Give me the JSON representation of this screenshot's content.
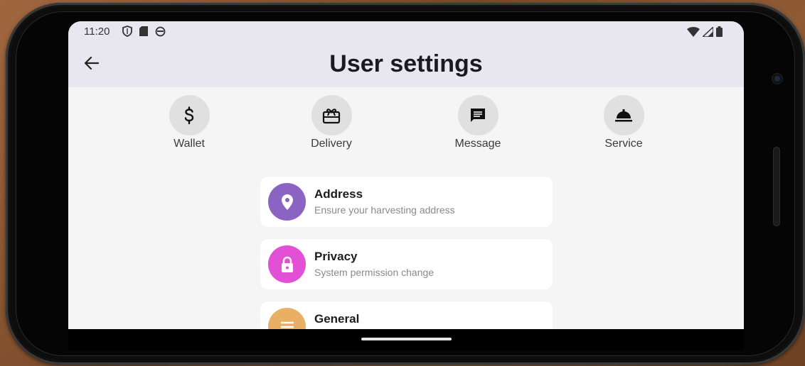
{
  "status_bar": {
    "time": "11:20",
    "left_icons": [
      "shield-icon",
      "sd-card-icon",
      "sync-icon"
    ],
    "right_icons": [
      "wifi-icon",
      "signal-icon",
      "battery-icon"
    ]
  },
  "header": {
    "title": "User settings",
    "back_icon": "arrow-left-icon"
  },
  "quick_actions": [
    {
      "label": "Wallet",
      "icon": "dollar-icon"
    },
    {
      "label": "Delivery",
      "icon": "gift-card-icon"
    },
    {
      "label": "Message",
      "icon": "message-icon"
    },
    {
      "label": "Service",
      "icon": "room-service-icon"
    }
  ],
  "settings": [
    {
      "title": "Address",
      "subtitle": "Ensure your harvesting address",
      "icon": "location-pin-icon",
      "color": "#8a63c3"
    },
    {
      "title": "Privacy",
      "subtitle": "System permission change",
      "icon": "lock-icon",
      "color": "#e250d6"
    },
    {
      "title": "General",
      "subtitle": "",
      "icon": "menu-icon",
      "color": "#e8b064"
    }
  ],
  "colors": {
    "appbar": "#e8e7ef",
    "screen_bg": "#f5f5f6",
    "quick_circle": "#e0e0e0"
  }
}
